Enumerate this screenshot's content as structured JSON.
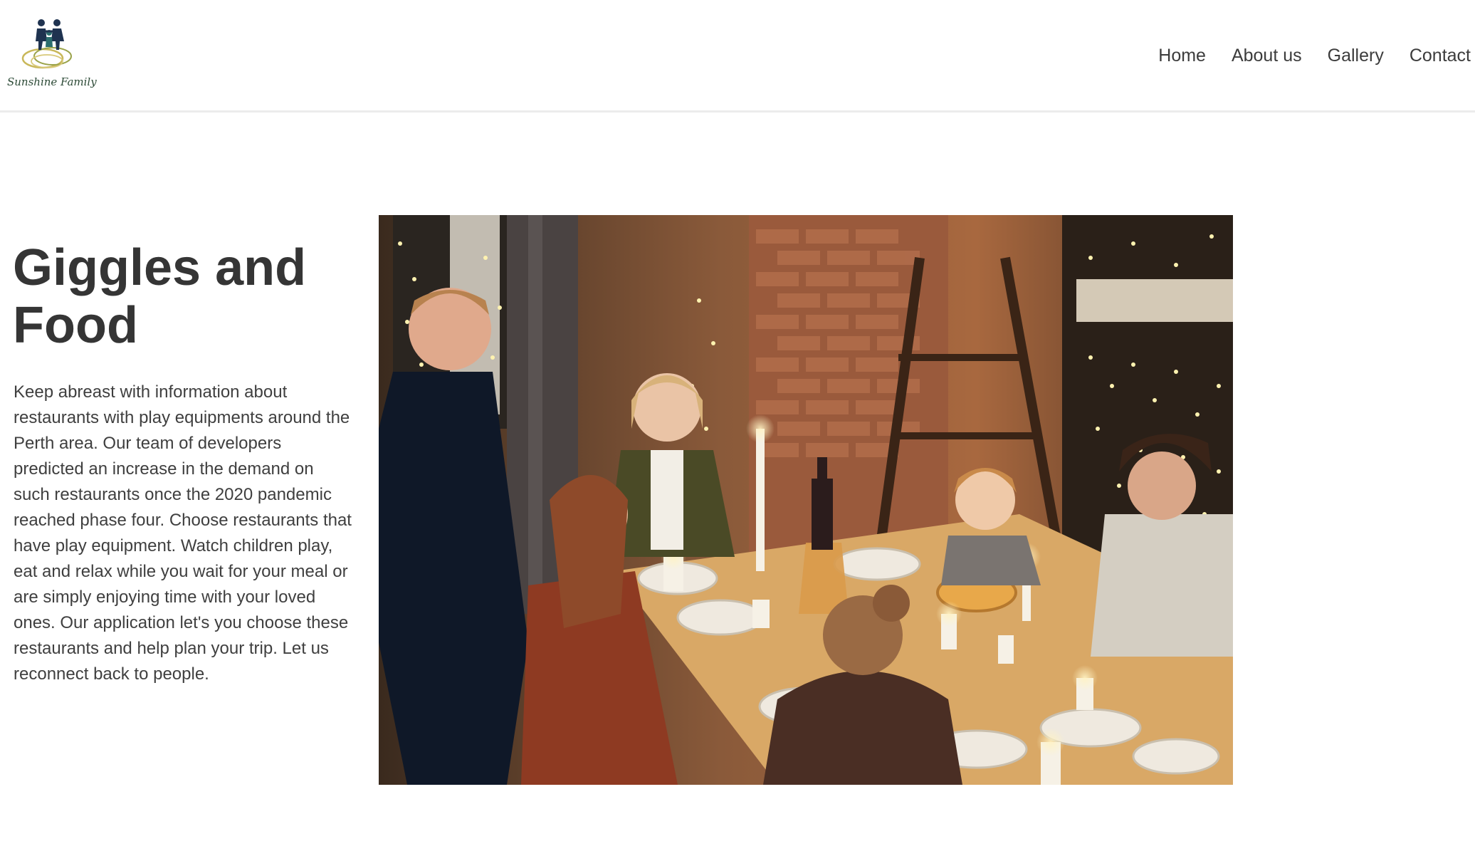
{
  "brand": {
    "name": "Sunshine Family",
    "logo_icon": "family-rings-logo-icon"
  },
  "nav": {
    "items": [
      {
        "label": "Home"
      },
      {
        "label": "About us"
      },
      {
        "label": "Gallery"
      },
      {
        "label": "Contact"
      }
    ]
  },
  "hero": {
    "title": "Giggles and Food",
    "body": "Keep abreast with information about restaurants with play equipments around the Perth area. Our team of developers predicted an increase in the demand on such restaurants once the 2020 pandemic reached phase four. Choose restaurants that have play equipment. Watch children play, eat and relax while you wait for your meal or are simply enjoying time with your loved ones. Our application let's you choose these restaurants and help plan your trip. Let us reconnect back to people.",
    "image_icon": "family-dinner-photo"
  },
  "colors": {
    "text": "#3c3c3c",
    "header_border": "#ececec",
    "logo_green": "#2c4a36",
    "logo_gold": "#c9b85a",
    "logo_navy": "#1f3350"
  }
}
